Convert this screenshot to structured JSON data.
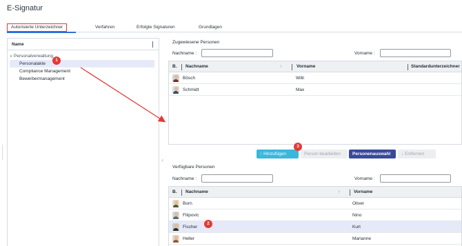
{
  "app": {
    "title": "E-Signatur"
  },
  "tabs": [
    {
      "label": "Autorisierte Unterzeichner",
      "active": true
    },
    {
      "label": "Verfahren"
    },
    {
      "label": "Erfolgte Signaturen"
    },
    {
      "label": "Grundlagen"
    }
  ],
  "tree": {
    "header": "Name",
    "items": [
      {
        "label": "Personalverwaltung",
        "level": 0,
        "expanded": true
      },
      {
        "label": "Personalakte",
        "level": 1,
        "selected": true
      },
      {
        "label": "Compliance Management",
        "level": 1
      },
      {
        "label": "Bewerbermanagement",
        "level": 1
      }
    ]
  },
  "assigned": {
    "title": "Zugewiesene Personen",
    "filter_lastname_label": "Nachname :",
    "filter_firstname_label": "Vorname :",
    "columns": {
      "b": "B.",
      "lastname": "Nachname",
      "firstname": "Vorname",
      "default_signer": "Standardunterzeichner"
    },
    "rows": [
      {
        "lastname": "Bösch",
        "firstname": "Willi"
      },
      {
        "lastname": "Schmidt",
        "firstname": "Max"
      }
    ]
  },
  "buttons": {
    "add": "Hinzufügen",
    "edit": "Person bearbeiten",
    "select": "Personenauswahl",
    "remove": "Entfernen"
  },
  "available": {
    "title": "Verfügbare Personen",
    "filter_lastname_label": "Nachname :",
    "filter_firstname_label": "Vorname :",
    "columns": {
      "b": "B.",
      "lastname": "Nachname",
      "firstname": "Vorname"
    },
    "rows": [
      {
        "lastname": "Born",
        "firstname": "Oliver"
      },
      {
        "lastname": "Filipovic",
        "firstname": "Nino"
      },
      {
        "lastname": "Fischer",
        "firstname": "Kurt",
        "highlight": true
      },
      {
        "lastname": "Heller",
        "firstname": "Marianne"
      }
    ]
  },
  "badges": {
    "one": "1",
    "two": "2",
    "three": "3"
  },
  "icons": {
    "sort": "arrow-up-icon",
    "add": "arrow-up-icon",
    "remove": "arrow-down-icon",
    "collapse": "chevron-left-icon",
    "expand": "chevron-down-icon"
  },
  "colors": {
    "accent": "#2f6fd6",
    "annotation": "#e53935",
    "add_button": "#3cb7dc",
    "select_button": "#3a4a9a",
    "selection": "#e6eaf8"
  }
}
